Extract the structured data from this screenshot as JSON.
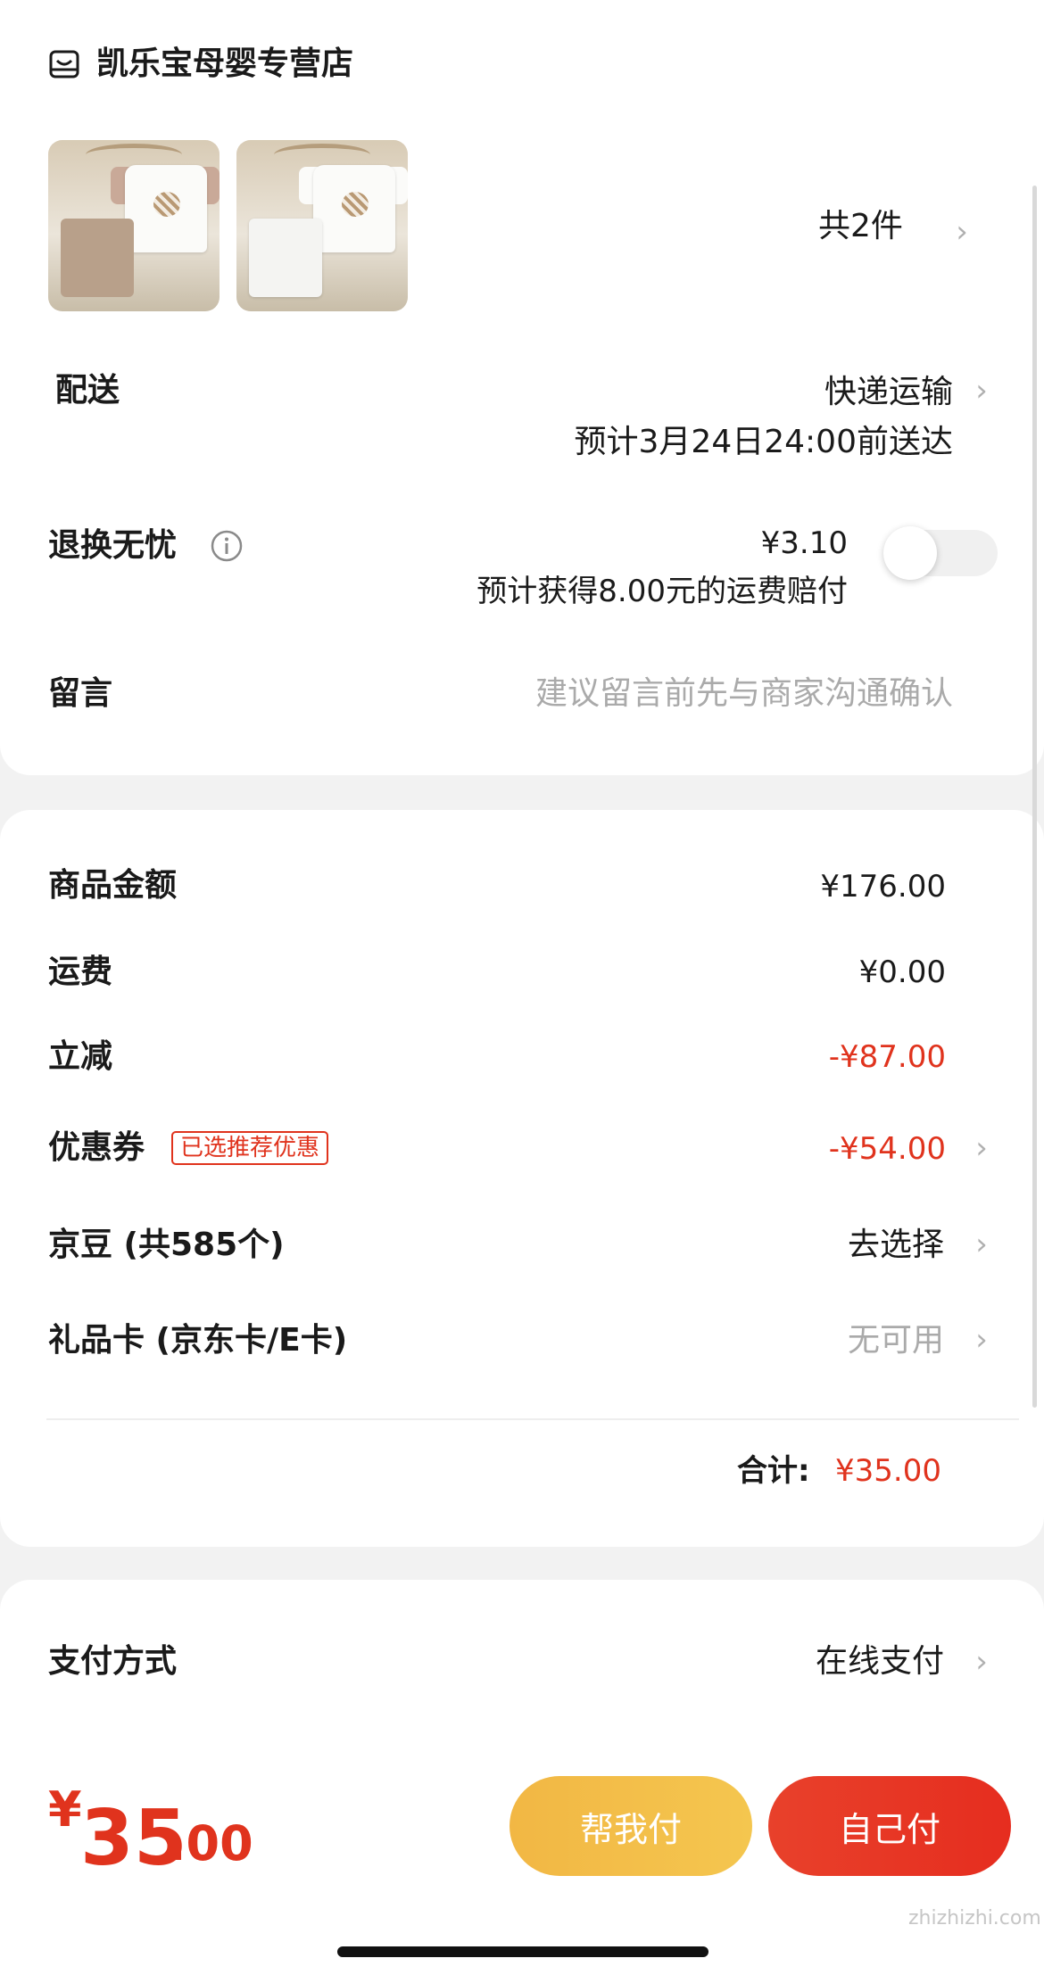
{
  "store": {
    "name": "凯乐宝母婴专营店",
    "icon": "store-icon"
  },
  "products": {
    "count_label": "共2件"
  },
  "delivery": {
    "label": "配送",
    "method": "快递运输",
    "eta": "预计3月24日24:00前送达"
  },
  "return_service": {
    "label": "退换无忧",
    "price": "¥3.10",
    "desc": "预计获得8.00元的运费赔付",
    "enabled": false
  },
  "message": {
    "label": "留言",
    "placeholder": "建议留言前先与商家沟通确认"
  },
  "costs": {
    "goods_label": "商品金额",
    "goods_value": "¥176.00",
    "shipping_label": "运费",
    "shipping_value": "¥0.00",
    "discount_label": "立减",
    "discount_value": "-¥87.00",
    "coupon_label": "优惠券",
    "coupon_tag": "已选推荐优惠",
    "coupon_value": "-¥54.00",
    "jd_beans_label": "京豆 (共585个)",
    "jd_beans_value": "去选择",
    "gift_card_label": "礼品卡 (京东卡/E卡)",
    "gift_card_value": "无可用",
    "total_label": "合计:",
    "total_value": "¥35.00"
  },
  "payment": {
    "label": "支付方式",
    "value": "在线支付"
  },
  "footer": {
    "currency": "¥",
    "amount_int": "35",
    "amount_dec": ".00",
    "help_pay": "帮我付",
    "self_pay": "自己付"
  },
  "watermark": {
    "text": "zhizhizhi.com"
  },
  "colors": {
    "accent_red": "#e0331d",
    "help_yellow": "#f3c24a",
    "self_red": "#e6351f"
  }
}
